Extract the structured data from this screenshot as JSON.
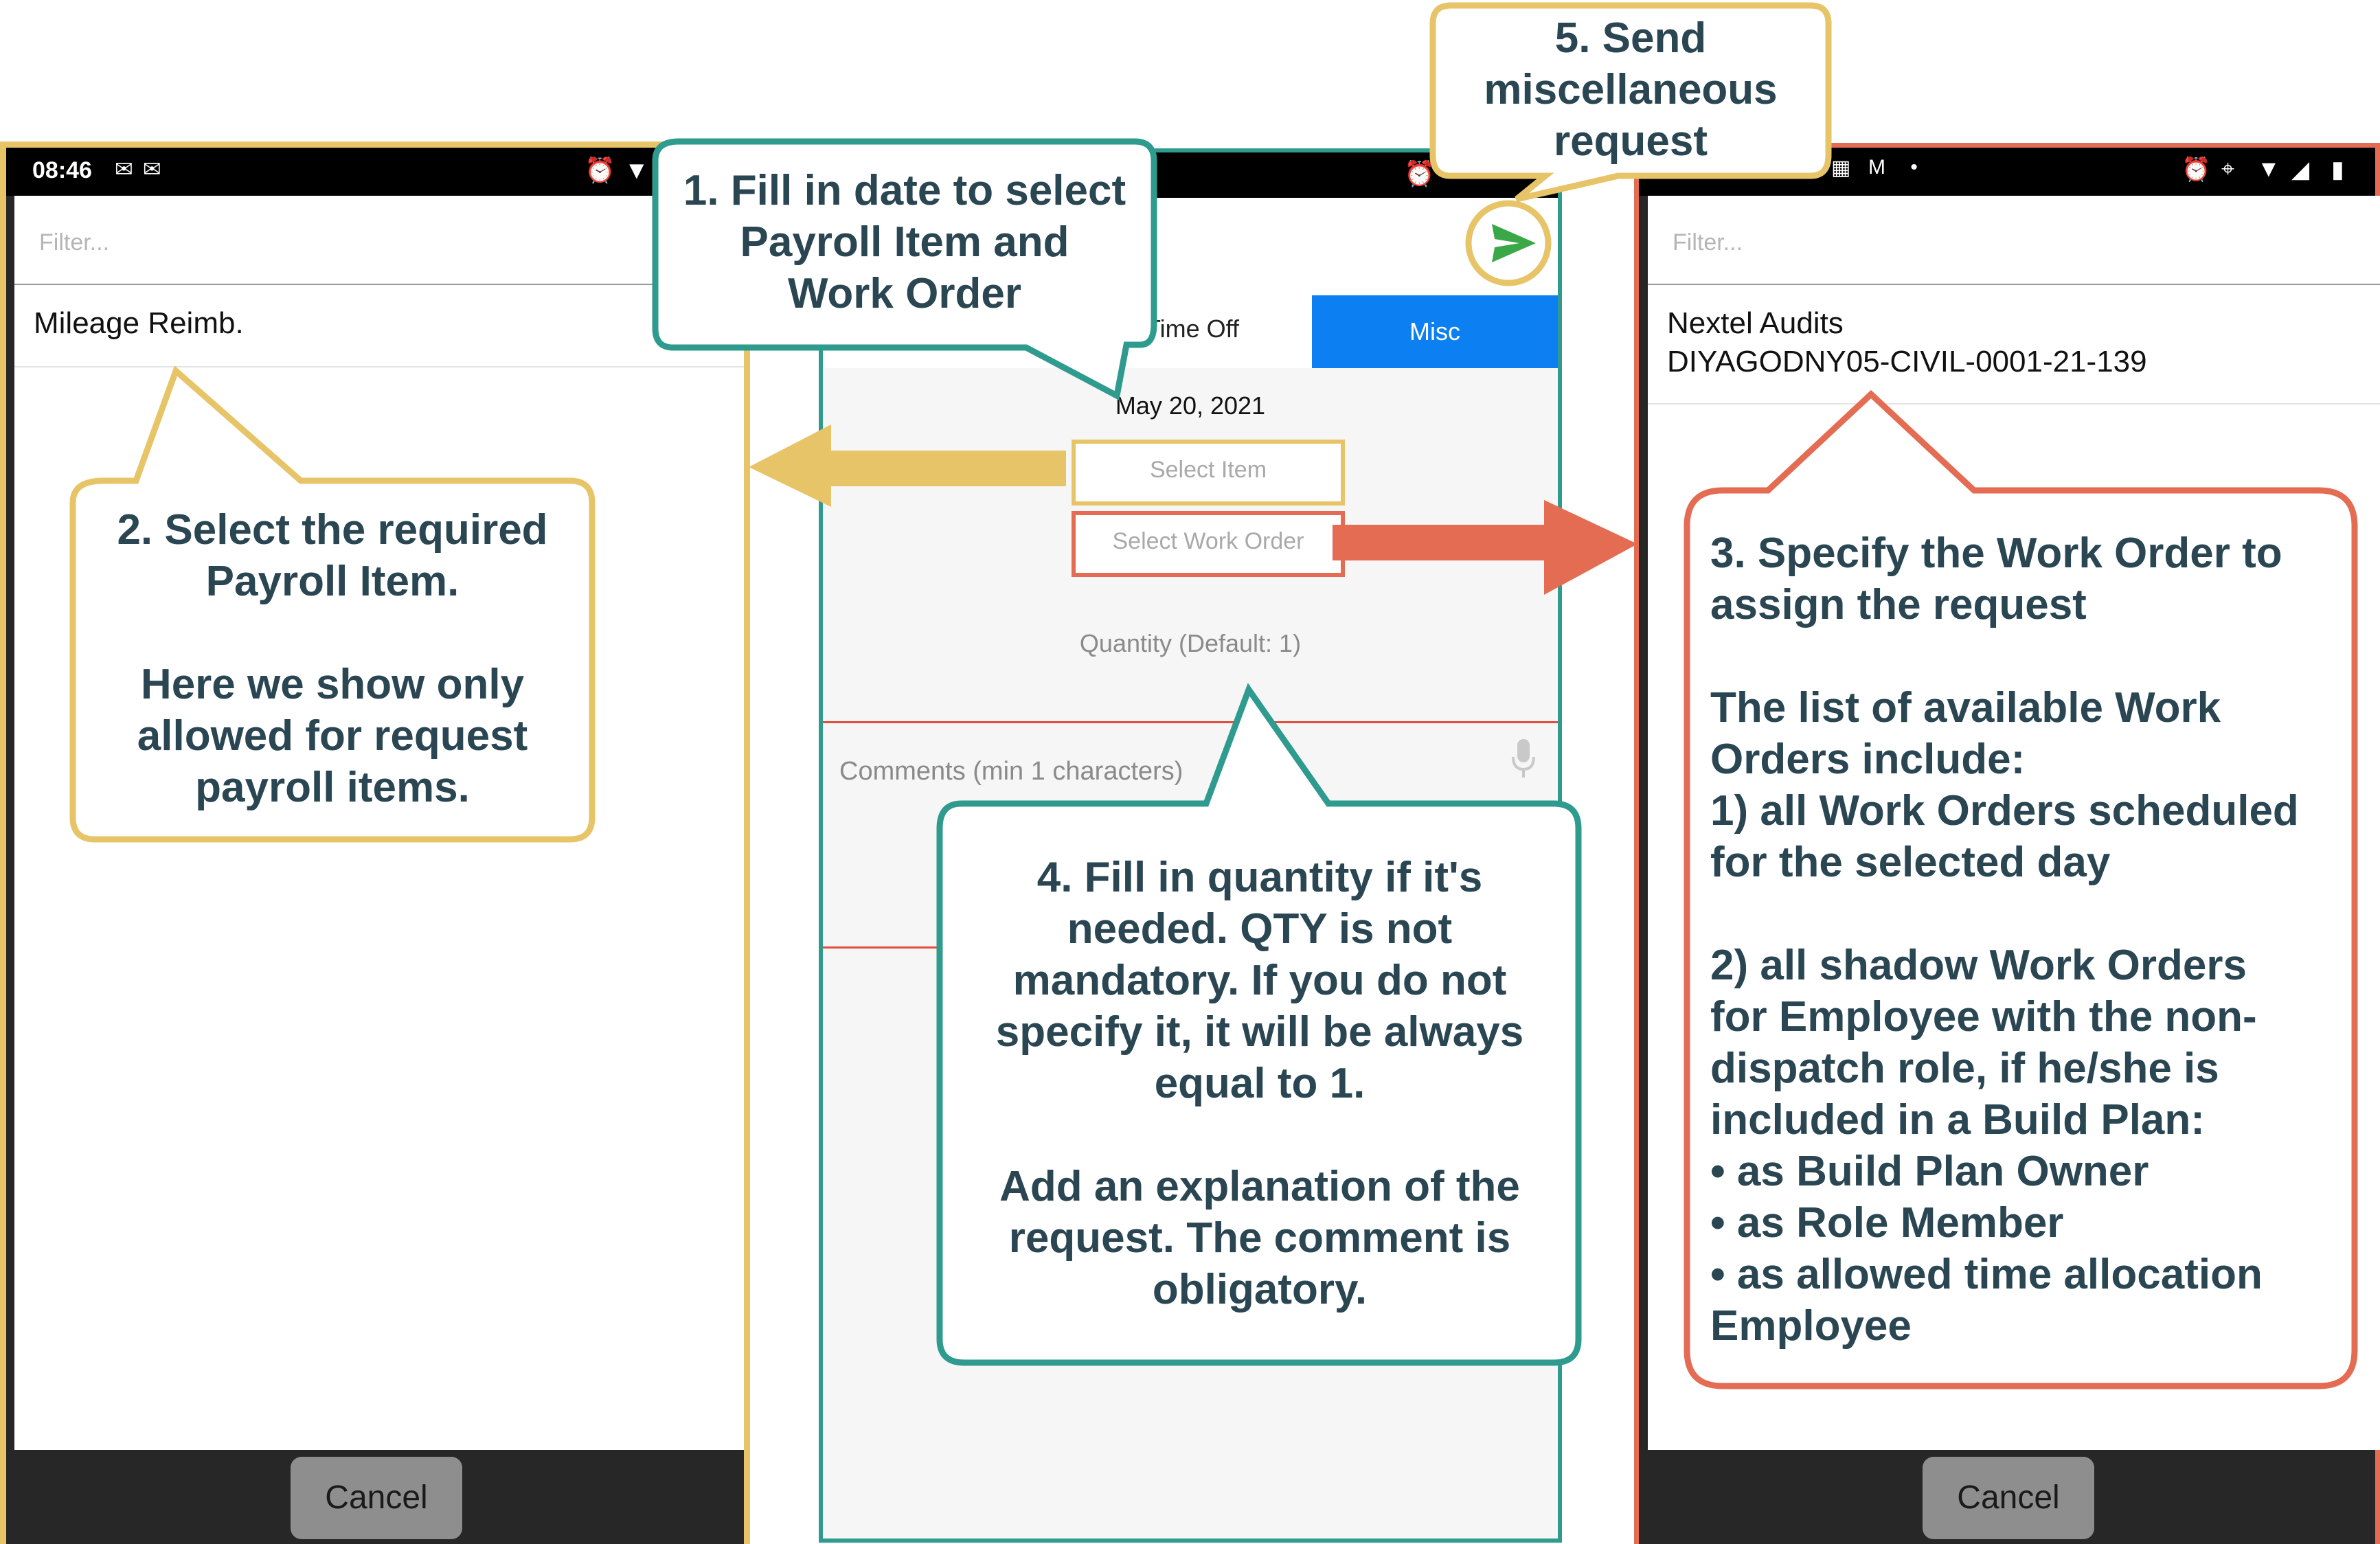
{
  "left_phone": {
    "status_time": "08:46",
    "filter_placeholder": "Filter...",
    "items": [
      {
        "label": "Mileage Reimb."
      }
    ],
    "cancel_label": "Cancel"
  },
  "middle_phone": {
    "tabs": [
      {
        "label": "Time Off"
      },
      {
        "label": "Misc"
      }
    ],
    "date": "May 20, 2021",
    "select_item_label": "Select Item",
    "select_work_order_label": "Select Work Order",
    "quantity_placeholder": "Quantity (Default: 1)",
    "comments_placeholder": "Comments (min 1 characters)"
  },
  "right_phone": {
    "filter_placeholder": "Filter...",
    "items": [
      {
        "line1": "Nextel Audits",
        "line2": "DIYAGODNY05-CIVIL-0001-21-139"
      }
    ],
    "cancel_label": "Cancel"
  },
  "callouts": {
    "step1": "1. Fill in date to select\nPayroll Item and\nWork Order",
    "step2": "2. Select the required\nPayroll Item.\n\nHere we show only\nallowed for request\npayroll items.",
    "step3": "3. Specify the Work Order to\nassign the request\n\nThe list of available Work\nOrders include:\n1) all Work Orders scheduled\nfor the selected day\n\n2) all shadow Work Orders\nfor Employee with the non-\ndispatch role, if he/she is\nincluded in a Build Plan:\n• as Build Plan Owner\n• as Role Member\n• as allowed time allocation\nEmployee",
    "step4": "4. Fill in quantity if it's\nneeded. QTY is not\nmandatory. If you do not\nspecify it, it will be always\nequal to 1.\n\nAdd an explanation of the\nrequest. The comment is\nobligatory.",
    "step5": "5. Send\nmiscellaneous\nrequest"
  },
  "colors": {
    "yellow": "#e7c468",
    "teal": "#2e9b8e",
    "coral": "#e36c53",
    "misc_tab": "#0c7ff2",
    "send_icon": "#3aa847",
    "callout_text": "#2a4652"
  },
  "icons": [
    "alarm-icon",
    "wifi-icon",
    "location-icon",
    "signal-icon",
    "battery-icon",
    "mic-icon",
    "send-icon",
    "calendar-icon",
    "gmail-icon"
  ]
}
